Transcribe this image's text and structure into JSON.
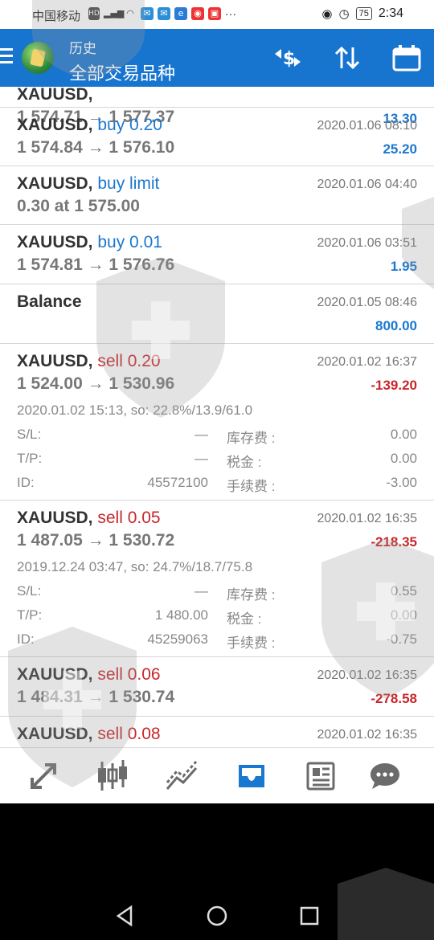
{
  "status_bar": {
    "carrier": "中国移动",
    "time": "2:34",
    "battery": "75"
  },
  "header": {
    "subtitle": "历史",
    "title": "全部交易品种"
  },
  "rows": [
    {
      "symbol": "XAUUSD,",
      "action": "",
      "prices": "1 574.71 → 1 577.37",
      "time": "",
      "profit": "13.30",
      "profit_sign": "pos"
    },
    {
      "symbol": "XAUUSD,",
      "action": "buy 0.20",
      "action_type": "buy",
      "prices": "1 574.84 → 1 576.10",
      "time": "2020.01.06 08:10",
      "profit": "25.20",
      "profit_sign": "pos"
    },
    {
      "symbol": "XAUUSD,",
      "action": "buy limit",
      "action_type": "buy",
      "prices": "0.30 at 1 575.00",
      "time": "2020.01.06 04:40",
      "profit": "",
      "profit_sign": "pos"
    },
    {
      "symbol": "XAUUSD,",
      "action": "buy 0.01",
      "action_type": "buy",
      "prices": "1 574.81 → 1 576.76",
      "time": "2020.01.06 03:51",
      "profit": "1.95",
      "profit_sign": "pos"
    },
    {
      "symbol": "Balance",
      "action": "",
      "action_type": "none",
      "prices": "",
      "time": "2020.01.05 08:46",
      "profit": "800.00",
      "profit_sign": "pos"
    },
    {
      "symbol": "XAUUSD,",
      "action": "sell 0.20",
      "action_type": "sell",
      "prices": "1 524.00 → 1 530.96",
      "time": "2020.01.02 16:37",
      "profit": "-139.20",
      "profit_sign": "neg",
      "open_info": "2020.01.02 15:13, so: 22.8%/13.9/61.0",
      "sl_label": "S/L:",
      "sl": "—",
      "tp_label": "T/P:",
      "tp": "—",
      "id_label": "ID:",
      "id": "45572100",
      "swap_label": "库存费 :",
      "swap": "0.00",
      "tax_label": "税金 :",
      "tax": "0.00",
      "fee_label": "手续费 :",
      "fee": "-3.00"
    },
    {
      "symbol": "XAUUSD,",
      "action": "sell 0.05",
      "action_type": "sell",
      "prices": "1 487.05 → 1 530.72",
      "time": "2020.01.02 16:35",
      "profit": "-218.35",
      "profit_sign": "neg",
      "open_info": "2019.12.24 03:47, so: 24.7%/18.7/75.8",
      "sl_label": "S/L:",
      "sl": "—",
      "tp_label": "T/P:",
      "tp": "1 480.00",
      "id_label": "ID:",
      "id": "45259063",
      "swap_label": "库存费 :",
      "swap": "0.55",
      "tax_label": "税金 :",
      "tax": "0.00",
      "fee_label": "手续费 :",
      "fee": "-0.75"
    },
    {
      "symbol": "XAUUSD,",
      "action": "sell 0.06",
      "action_type": "sell",
      "prices": "1 484.31 → 1 530.74",
      "time": "2020.01.02 16:35",
      "profit": "-278.58",
      "profit_sign": "neg"
    },
    {
      "symbol": "XAUUSD,",
      "action": "sell 0.08",
      "action_type": "sell",
      "prices": "",
      "time": "2020.01.02 16:35",
      "profit": "",
      "profit_sign": "neg"
    }
  ],
  "bottom_nav": [
    {
      "name": "quotes-tab",
      "icon": "arrows-icon"
    },
    {
      "name": "chart-tab",
      "icon": "candlestick-icon"
    },
    {
      "name": "trade-tab",
      "icon": "trend-lines-icon"
    },
    {
      "name": "history-tab",
      "icon": "inbox-icon",
      "active": true
    },
    {
      "name": "news-tab",
      "icon": "newspaper-icon"
    },
    {
      "name": "chat-tab",
      "icon": "chat-bubble-icon"
    }
  ],
  "colors": {
    "header_bg": "#1775d0",
    "buy": "#1b78d0",
    "sell": "#c8262a",
    "active_tab": "#1b78d0",
    "inactive_tab": "#6b6b6b"
  }
}
